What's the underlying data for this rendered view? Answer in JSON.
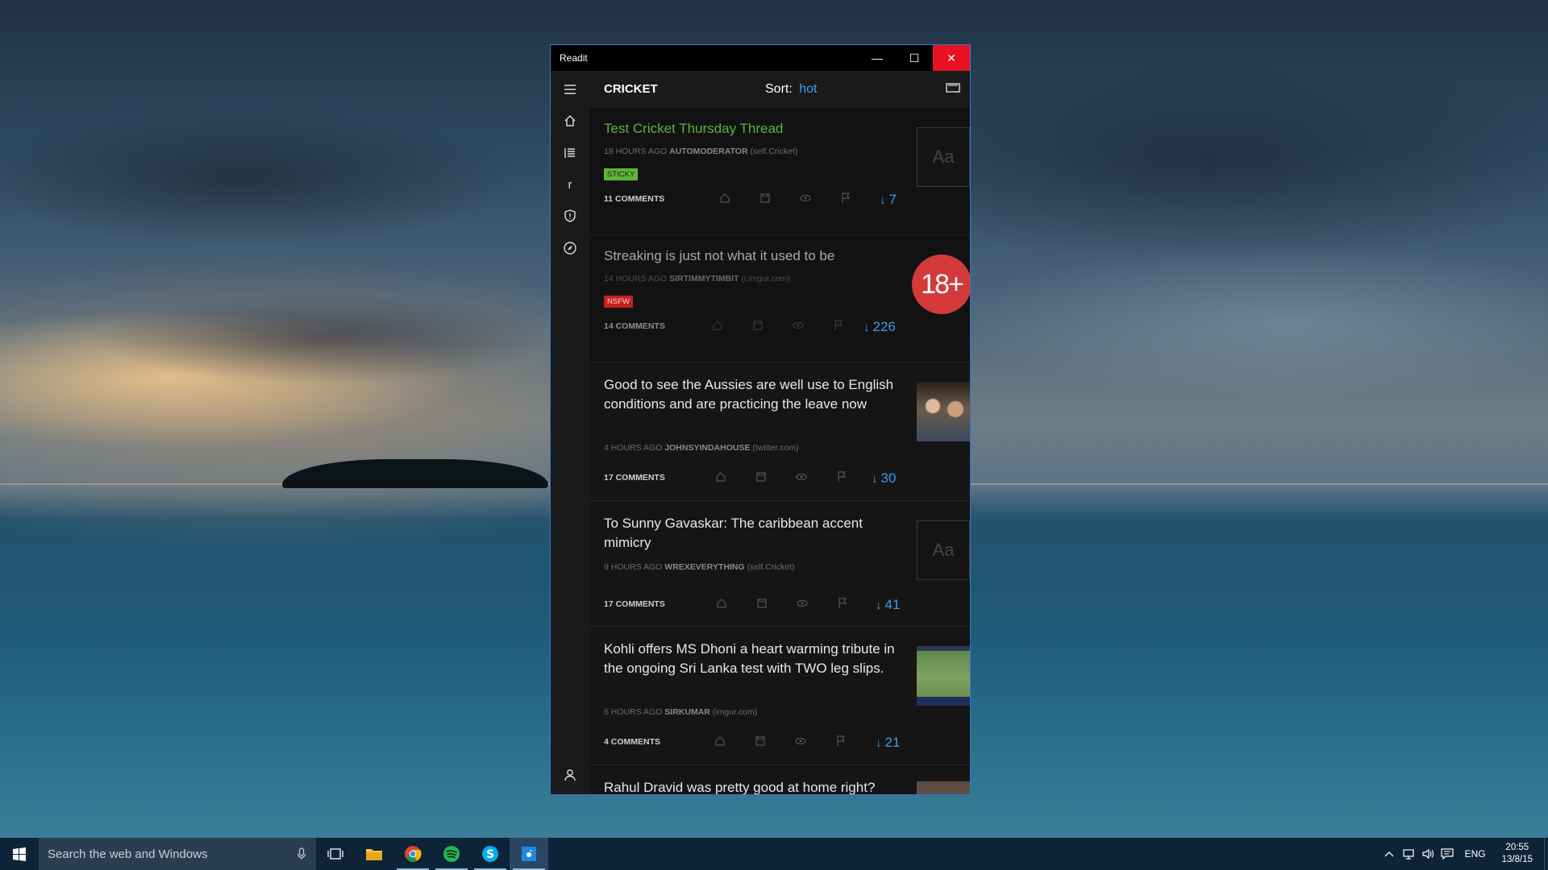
{
  "window": {
    "title": "Readit",
    "controls": {
      "minimize": "—",
      "maximize": "☐",
      "close": "✕"
    }
  },
  "header": {
    "subreddit": "CRICKET",
    "sort_label": "Sort:",
    "sort_value": "hot"
  },
  "sidebar": {
    "items": [
      {
        "icon": "hamburger-menu-icon"
      },
      {
        "icon": "home-icon"
      },
      {
        "icon": "list-icon"
      },
      {
        "icon": "subreddit-r-icon",
        "glyph": "r"
      },
      {
        "icon": "shield-icon"
      },
      {
        "icon": "compass-icon"
      },
      {
        "icon": "user-icon"
      }
    ]
  },
  "posts": [
    {
      "title": "Test Cricket Thursday Thread",
      "time": "18 HOURS AGO",
      "author": "AUTOMODERATOR",
      "domain": "(self.Cricket)",
      "badge": "STICKY",
      "comments": "11 COMMENTS",
      "score": "7",
      "thumb": "Aa"
    },
    {
      "title": "Streaking is just not what it used to be",
      "time": "14 HOURS AGO",
      "author": "SIRTIMMYTIMBIT",
      "domain": "(i.imgur.com)",
      "badge": "NSFW",
      "comments": "14 COMMENTS",
      "score": "226",
      "thumb": "18+"
    },
    {
      "title": "Good to see the Aussies are well use to English conditions and are practicing the leave now",
      "time": "4 HOURS AGO",
      "author": "JOHNSYINDAHOUSE",
      "domain": "(twitter.com)",
      "comments": "17 COMMENTS",
      "score": "30"
    },
    {
      "title": "To Sunny Gavaskar: The caribbean accent mimicry",
      "time": "9 HOURS AGO",
      "author": "WREXEVERYTHING",
      "domain": "(self.Cricket)",
      "comments": "17 COMMENTS",
      "score": "41",
      "thumb": "Aa"
    },
    {
      "title": "Kohli offers MS Dhoni a heart warming tribute in the ongoing Sri Lanka test with TWO leg slips.",
      "time": "6 HOURS AGO",
      "author": "SIRKUMAR",
      "domain": "(imgur.com)",
      "comments": "4 COMMENTS",
      "score": "21"
    },
    {
      "title": "Rahul Dravid was pretty good at home right?"
    }
  ],
  "taskbar": {
    "search_placeholder": "Search the web and Windows",
    "apps": [
      "task-view-icon",
      "file-explorer-icon",
      "chrome-icon",
      "spotify-icon",
      "skype-icon",
      "readit-icon"
    ],
    "language": "ENG",
    "time": "20:55",
    "date": "13/8/15"
  },
  "colors": {
    "accent": "#3a9ef0",
    "sticky": "#5fb33a",
    "nsfw": "#c42020",
    "close": "#e81123"
  }
}
